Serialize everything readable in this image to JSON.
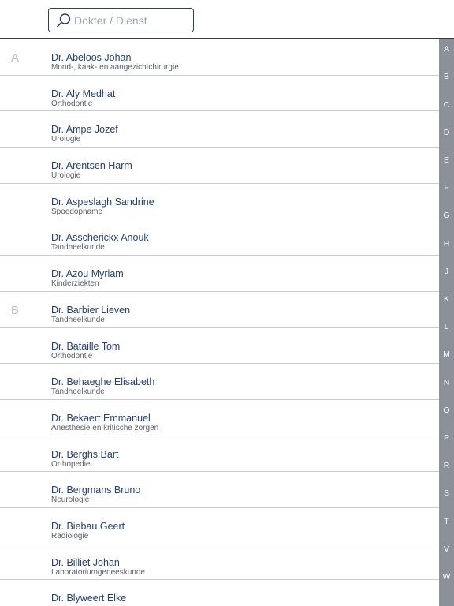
{
  "search": {
    "placeholder": "Dokter / Dienst"
  },
  "rows": [
    {
      "section": "A",
      "name": "Dr. Abeloos Johan",
      "specialty": "Mond-, kaak- en aangezichtchirurgie"
    },
    {
      "section": "",
      "name": "Dr. Aly Medhat",
      "specialty": "Orthodontie"
    },
    {
      "section": "",
      "name": "Dr. Ampe Jozef",
      "specialty": "Urologie"
    },
    {
      "section": "",
      "name": "Dr. Arentsen Harm",
      "specialty": "Urologie"
    },
    {
      "section": "",
      "name": "Dr. Aspeslagh Sandrine",
      "specialty": "Spoedopname"
    },
    {
      "section": "",
      "name": "Dr. Asscherickx Anouk",
      "specialty": "Tandheelkunde"
    },
    {
      "section": "",
      "name": "Dr. Azou Myriam",
      "specialty": "Kinderziekten"
    },
    {
      "section": "B",
      "name": "Dr. Barbier Lieven",
      "specialty": "Tandheelkunde"
    },
    {
      "section": "",
      "name": "Dr. Bataille Tom",
      "specialty": "Orthodontie"
    },
    {
      "section": "",
      "name": "Dr. Behaeghe Elisabeth",
      "specialty": "Tandheelkunde"
    },
    {
      "section": "",
      "name": "Dr. Bekaert Emmanuel",
      "specialty": "Anesthesie en kritische zorgen"
    },
    {
      "section": "",
      "name": "Dr. Berghs Bart",
      "specialty": "Orthopedie"
    },
    {
      "section": "",
      "name": "Dr. Bergmans Bruno",
      "specialty": "Neurologie"
    },
    {
      "section": "",
      "name": "Dr. Biebau Geert",
      "specialty": "Radiologie"
    },
    {
      "section": "",
      "name": "Dr. Billiet Johan",
      "specialty": "Laboratoriumgeneeskunde"
    },
    {
      "section": "",
      "name": "Dr. Blyweert Elke",
      "specialty": ""
    }
  ],
  "index_letters": [
    "A",
    "B",
    "C",
    "D",
    "E",
    "F",
    "G",
    "H",
    "J",
    "K",
    "L",
    "M",
    "N",
    "O",
    "P",
    "R",
    "S",
    "T",
    "V",
    "W"
  ],
  "colors": {
    "accent": "#22407a",
    "index_bar": "#8b9099",
    "divider": "#c9ccd3"
  },
  "icons": {
    "search": "search-icon"
  }
}
